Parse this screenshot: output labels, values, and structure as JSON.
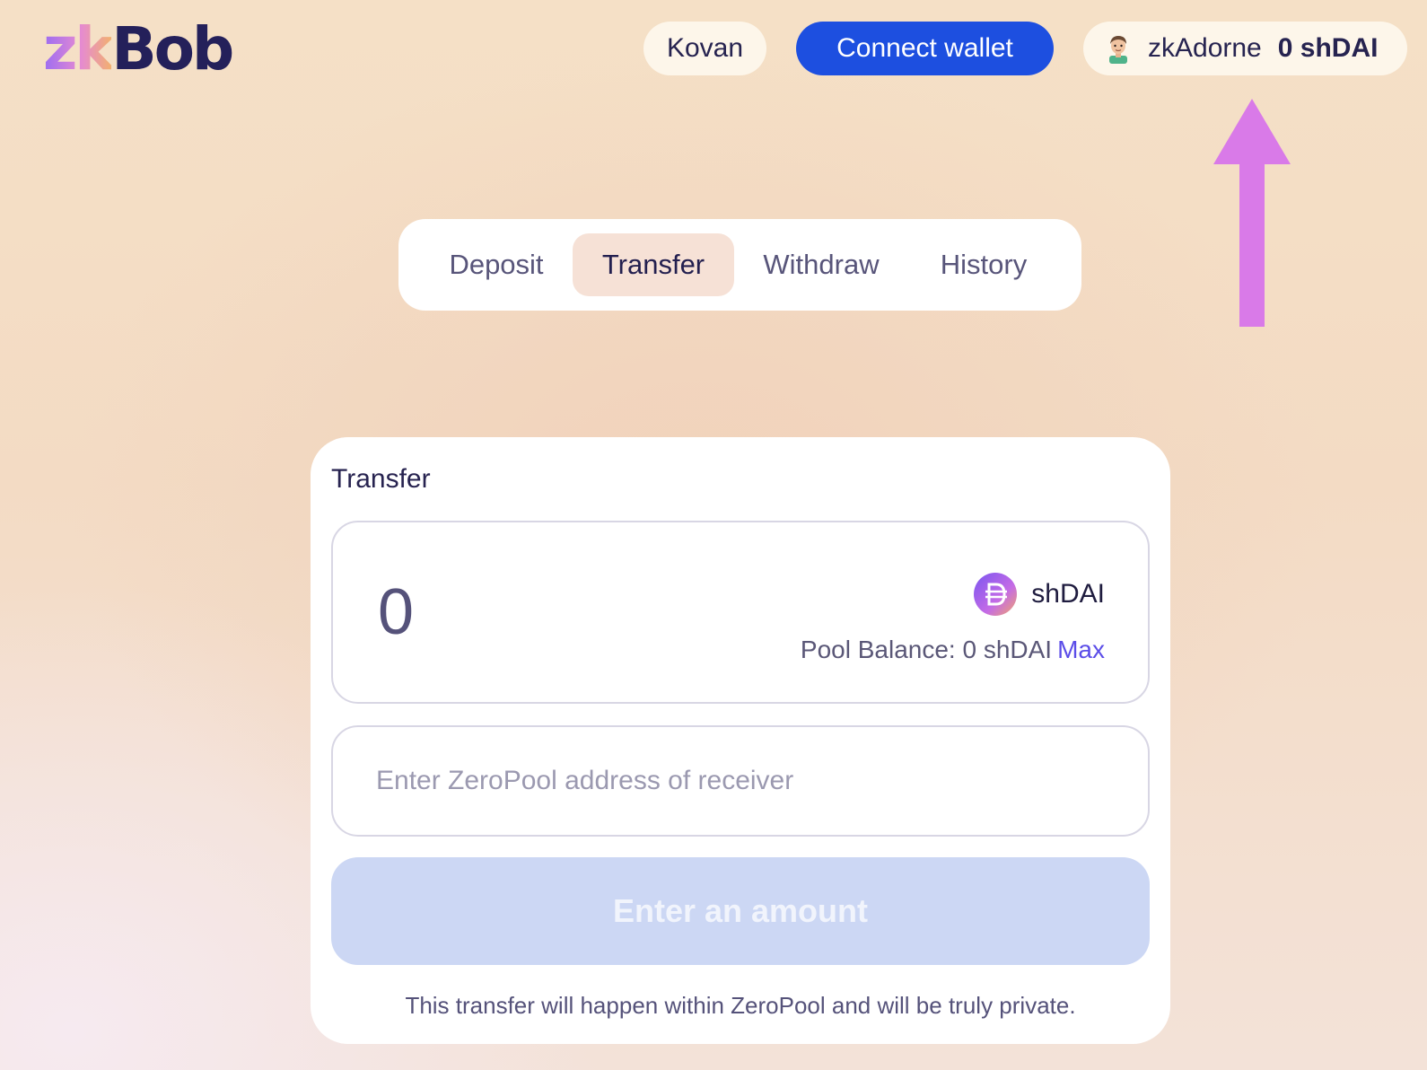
{
  "header": {
    "logo": {
      "prefix": "zk",
      "suffix": "Bob"
    },
    "network_label": "Kovan",
    "connect_label": "Connect wallet",
    "account": {
      "avatar_icon": "avatar-icon",
      "name": "zkAdorne",
      "balance": "0 shDAI"
    }
  },
  "tabs": [
    {
      "label": "Deposit",
      "active": false
    },
    {
      "label": "Transfer",
      "active": true
    },
    {
      "label": "Withdraw",
      "active": false
    },
    {
      "label": "History",
      "active": false
    }
  ],
  "transfer": {
    "title": "Transfer",
    "amount_value": "0",
    "token": {
      "icon": "dai-token-icon",
      "symbol": "shDAI"
    },
    "pool_balance_label": "Pool Balance: 0 shDAI",
    "max_label": "Max",
    "address_placeholder": "Enter ZeroPool address of receiver",
    "address_value": "",
    "submit_label": "Enter an amount",
    "note": "This transfer will happen within ZeroPool and will be truly private."
  },
  "annotation": {
    "arrow_icon": "up-arrow-icon",
    "color": "#d97ae8"
  },
  "colors": {
    "primary": "#1d4fe0",
    "accent_link": "#5b4de8",
    "active_tab_bg": "#f6e1d6",
    "disabled_button_bg": "#ccd7f4"
  }
}
